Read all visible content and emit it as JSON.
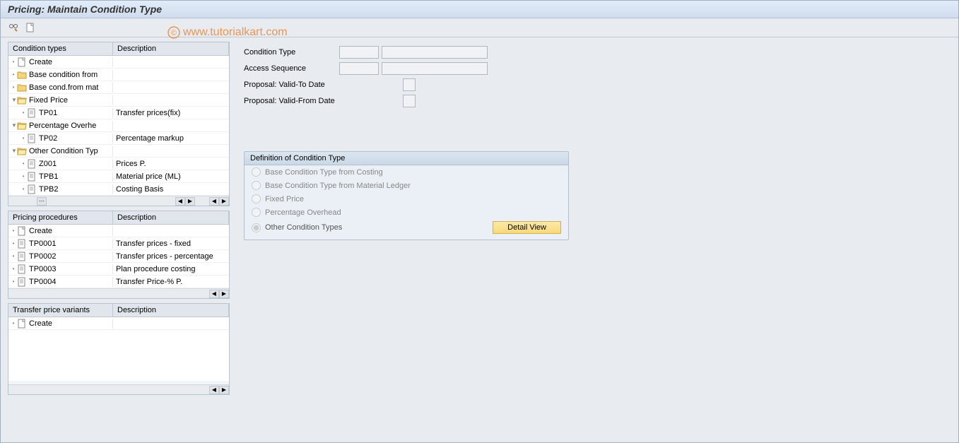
{
  "title": "Pricing: Maintain Condition Type",
  "watermark": "www.tutorialkart.com",
  "toolbar": {
    "t1": "glasses-pencil",
    "t2": "new-doc"
  },
  "panel1": {
    "h1": "Condition types",
    "h2": "Description",
    "rows": [
      {
        "indent": 0,
        "ic": "doc",
        "label": "Create",
        "desc": ""
      },
      {
        "indent": 0,
        "ic": "folder",
        "label": "Base condition from",
        "desc": ""
      },
      {
        "indent": 0,
        "ic": "folder",
        "label": "Base cond.from mat",
        "desc": ""
      },
      {
        "indent": 0,
        "ic": "folder-open",
        "exp": "▼",
        "label": "Fixed Price",
        "desc": ""
      },
      {
        "indent": 1,
        "ic": "page",
        "label": "TP01",
        "desc": "Transfer prices(fix)"
      },
      {
        "indent": 0,
        "ic": "folder-open",
        "exp": "▼",
        "label": "Percentage Overhe",
        "desc": ""
      },
      {
        "indent": 1,
        "ic": "page",
        "label": "TP02",
        "desc": "Percentage markup"
      },
      {
        "indent": 0,
        "ic": "folder-open",
        "exp": "▼",
        "label": "Other Condition Typ",
        "desc": ""
      },
      {
        "indent": 1,
        "ic": "page",
        "label": "Z001",
        "desc": "Prices P."
      },
      {
        "indent": 1,
        "ic": "page",
        "label": "TPB1",
        "desc": "Material price (ML)"
      },
      {
        "indent": 1,
        "ic": "page",
        "label": "TPB2",
        "desc": "Costing Basis"
      }
    ]
  },
  "panel2": {
    "h1": "Pricing procedures",
    "h2": "Description",
    "rows": [
      {
        "indent": 0,
        "ic": "doc",
        "label": "Create",
        "desc": ""
      },
      {
        "indent": 0,
        "ic": "page",
        "label": "TP0001",
        "desc": "Transfer prices - fixed"
      },
      {
        "indent": 0,
        "ic": "page",
        "label": "TP0002",
        "desc": "Transfer prices - percentage"
      },
      {
        "indent": 0,
        "ic": "page",
        "label": "TP0003",
        "desc": "Plan procedure costing"
      },
      {
        "indent": 0,
        "ic": "page",
        "label": "TP0004",
        "desc": "Transfer Price-% P."
      }
    ]
  },
  "panel3": {
    "h1": "Transfer price variants",
    "h2": "Description",
    "rows": [
      {
        "indent": 0,
        "ic": "doc",
        "label": "Create",
        "desc": ""
      }
    ]
  },
  "form": {
    "f1": "Condition Type",
    "f2": "Access Sequence",
    "f3": "Proposal: Valid-To Date",
    "f4": "Proposal: Valid-From Date"
  },
  "group": {
    "title": "Definition of Condition Type",
    "r1": "Base Condition Type from Costing",
    "r2": "Base Condition Type from Material Ledger",
    "r3": "Fixed Price",
    "r4": "Percentage Overhead",
    "r5": "Other Condition Types",
    "btn": "Detail View"
  }
}
